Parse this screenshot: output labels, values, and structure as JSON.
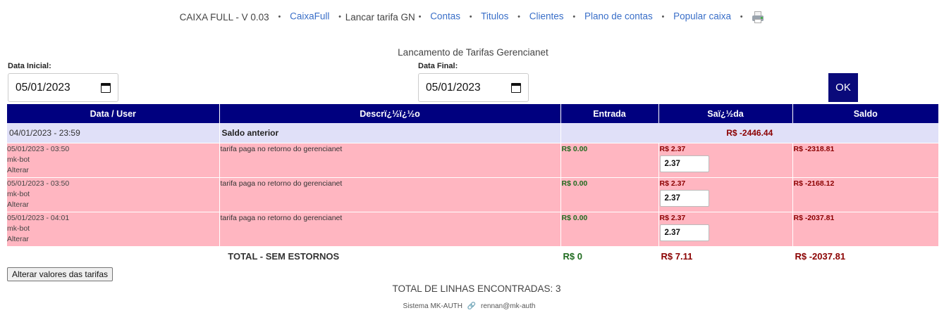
{
  "nav": {
    "app_title": "CAIXA FULL - V 0.03",
    "items": [
      {
        "label": "CaixaFull"
      },
      {
        "label": "Lancar tarifa GN"
      },
      {
        "label": "Contas"
      },
      {
        "label": "Titulos"
      },
      {
        "label": "Clientes"
      },
      {
        "label": "Plano de contas"
      },
      {
        "label": "Popular caixa"
      }
    ],
    "separator": "•"
  },
  "page_title": "Lancamento de Tarifas Gerencianet",
  "filters": {
    "start_label": "Data Inicial:",
    "start_value": "05/01/2023",
    "end_label": "Data Final:",
    "end_value": "05/01/2023",
    "ok_label": "OK"
  },
  "table": {
    "headers": [
      "Data / User",
      "Descrï¿½ï¿½o",
      "Entrada",
      "Saï¿½da",
      "Saldo"
    ],
    "previous": {
      "date": "04/01/2023 - 23:59",
      "label": "Saldo anterior",
      "saldo": "R$ -2446.44"
    },
    "rows": [
      {
        "date": "05/01/2023 - 03:50",
        "user": "mk-bot",
        "action": "Alterar",
        "desc": "tarifa paga no retorno do gerencianet",
        "entrada": "R$ 0.00",
        "saida": "R$ 2.37",
        "tarifa": "2.37",
        "saldo": "R$ -2318.81"
      },
      {
        "date": "05/01/2023 - 03:50",
        "user": "mk-bot",
        "action": "Alterar",
        "desc": "tarifa paga no retorno do gerencianet",
        "entrada": "R$ 0.00",
        "saida": "R$ 2.37",
        "tarifa": "2.37",
        "saldo": "R$ -2168.12"
      },
      {
        "date": "05/01/2023 - 04:01",
        "user": "mk-bot",
        "action": "Alterar",
        "desc": "tarifa paga no retorno do gerencianet",
        "entrada": "R$ 0.00",
        "saida": "R$ 2.37",
        "tarifa": "2.37",
        "saldo": "R$ -2037.81"
      }
    ],
    "total": {
      "label": "TOTAL - SEM ESTORNOS",
      "entrada": "R$ 0",
      "saida": "R$ 7.11",
      "saldo": "R$ -2037.81"
    }
  },
  "alter_button": "Alterar valores das tarifas",
  "count_text": "TOTAL DE LINHAS ENCONTRADAS: 3",
  "footer": {
    "system": "Sistema MK-AUTH",
    "link_icon": "🔗",
    "email": "rennan@mk-auth"
  },
  "colors": {
    "header_bg": "#00007f",
    "row_bg": "#ffb6c1",
    "prev_bg": "#e0e0f8",
    "positive": "#1f6b1f",
    "negative": "#8b0000",
    "link": "#3a6fc8"
  },
  "icons": {
    "print": "printer-icon",
    "calendar": "calendar-icon",
    "link": "link-icon"
  }
}
